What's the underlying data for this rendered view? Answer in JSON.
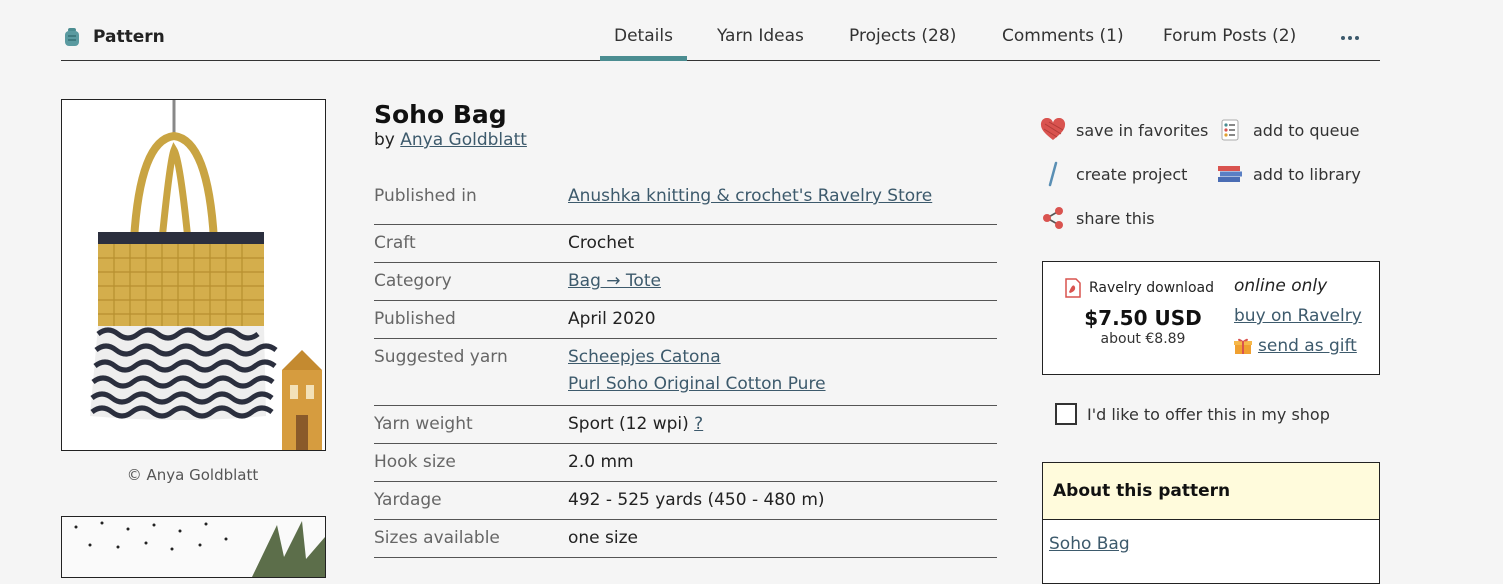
{
  "nav": {
    "brand": "Pattern",
    "tabs": [
      {
        "label": "Details",
        "active": true
      },
      {
        "label": "Yarn Ideas"
      },
      {
        "label": "Projects (28)"
      },
      {
        "label": "Comments (1)"
      },
      {
        "label": "Forum Posts (2)"
      }
    ],
    "more_icon": "ellipsis-icon"
  },
  "photo": {
    "caption": "© Anya Goldblatt"
  },
  "pattern": {
    "title": "Soho Bag",
    "by_prefix": "by",
    "author": "Anya Goldblatt"
  },
  "details": [
    {
      "label": "Published in",
      "values": [
        "Anushka knitting & crochet's Ravelry Store"
      ],
      "link": true
    },
    {
      "label": "Craft",
      "values": [
        "Crochet"
      ]
    },
    {
      "label": "Category",
      "values": [
        "Bag → Tote"
      ],
      "link": true
    },
    {
      "label": "Published",
      "values": [
        "April 2020"
      ]
    },
    {
      "label": "Suggested yarn",
      "values": [
        "Scheepjes Catona",
        "Purl Soho Original Cotton Pure"
      ],
      "link": true
    },
    {
      "label": "Yarn weight",
      "values": [
        "Sport (12 wpi)"
      ],
      "help": "?"
    },
    {
      "label": "Hook size",
      "values": [
        "2.0 mm"
      ]
    },
    {
      "label": "Yardage",
      "values": [
        "492 - 525 yards (450 - 480 m)"
      ]
    },
    {
      "label": "Sizes available",
      "values": [
        "one size"
      ]
    }
  ],
  "actions": {
    "favorites": "save in favorites",
    "queue": "add to queue",
    "project": "create project",
    "library": "add to library",
    "share": "share this"
  },
  "purchase": {
    "download": "Ravelry download",
    "price": "$7.50 USD",
    "price_eur": "about €8.89",
    "availability": "online only",
    "buy": "buy on Ravelry",
    "gift": "send as gift"
  },
  "shop_offer": "I'd like to offer this in my shop",
  "about": {
    "heading": "About this pattern",
    "name": "Soho Bag"
  },
  "colors": {
    "accent": "#4b8d91",
    "link": "#3d5a6c",
    "about_header": "#fffbdc"
  }
}
